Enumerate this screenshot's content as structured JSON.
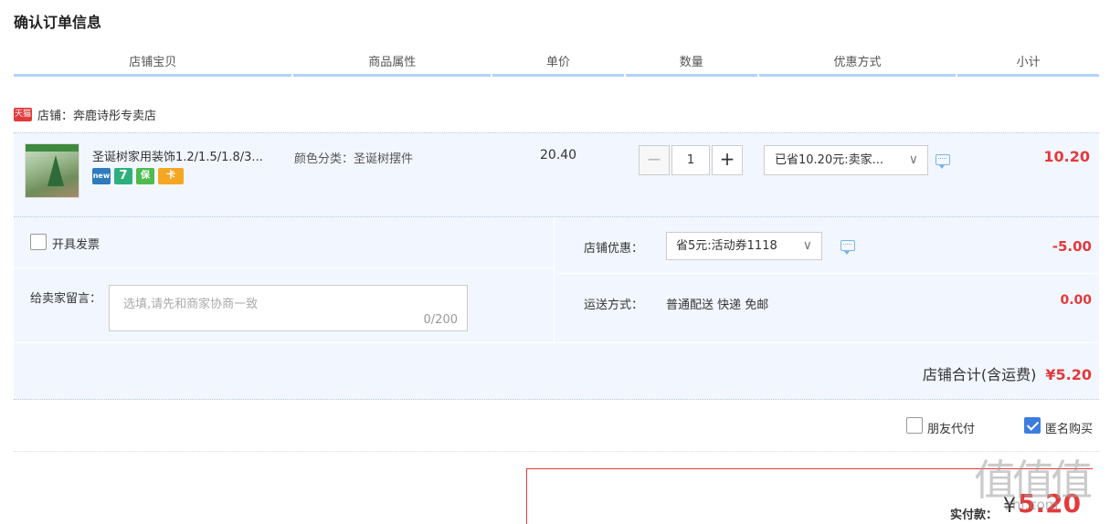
{
  "page": {
    "title": "确认订单信息"
  },
  "columns": [
    "店铺宝贝",
    "商品属性",
    "单价",
    "数量",
    "优惠方式",
    "小计"
  ],
  "shop": {
    "badge": "天猫",
    "label": "店铺：奔鹿诗彤专卖店"
  },
  "item": {
    "title": "圣诞树家用装饰1.2/1.5/1.8/3...",
    "attribute": "颜色分类：圣诞树摆件",
    "unit_price": "20.40",
    "quantity": "1",
    "minus": "−",
    "plus": "+",
    "discount": "已省10.20元:卖家...",
    "subtotal": "10.20",
    "service_icons": [
      "new",
      "7",
      "保",
      "卡"
    ]
  },
  "extras": {
    "invoice_label": "开具发票",
    "message_label": "给卖家留言：",
    "message_placeholder": "选填,请先和商家协商一致",
    "message_count": "0/200",
    "shop_discount_label": "店铺优惠：",
    "shop_discount_value": "省5元:活动券1118",
    "shop_discount_amount": "-5.00",
    "shipping_label": "运送方式：",
    "shipping_value": "普通配送 快递 免邮",
    "shipping_amount": "0.00",
    "total_label": "店铺合计(含运费)",
    "total_value": "¥5.20"
  },
  "options": {
    "friend_pay": "朋友代付",
    "friend_pay_checked": false,
    "anonymous": "匿名购买",
    "anonymous_checked": true
  },
  "payment": {
    "label": "实付款：",
    "currency": "¥",
    "amount": "5.20"
  },
  "watermark": {
    "chars": "值值值",
    "url": "zhi.com"
  },
  "colors": {
    "accent": "#e4393c",
    "header_line": "#b2d1ff",
    "panel": "#f2f7ff",
    "check": "#3c7de0"
  }
}
